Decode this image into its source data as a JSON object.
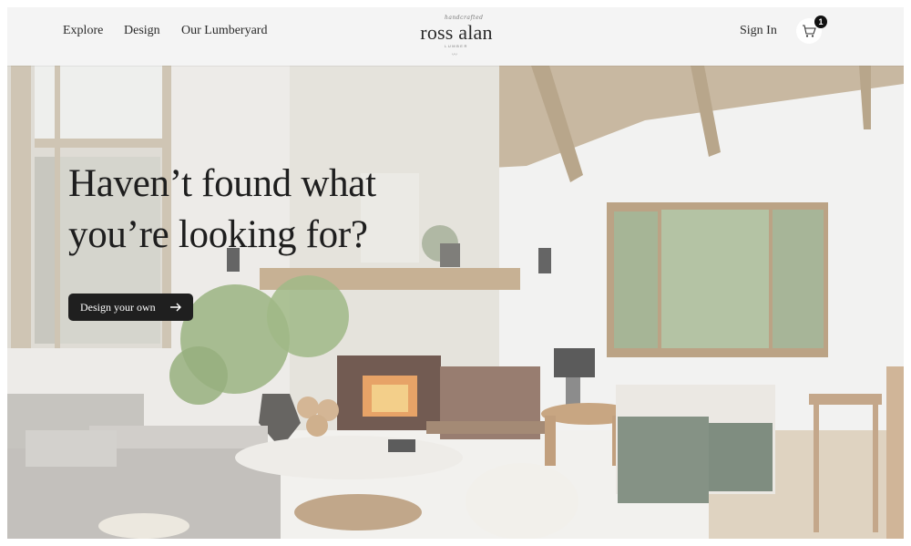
{
  "nav": {
    "links": [
      "Explore",
      "Design",
      "Our Lumberyard"
    ],
    "sign_in": "Sign In",
    "cart_count": "1"
  },
  "logo": {
    "script": "handcrafted",
    "name": "ross alan",
    "sub": "LUMBER"
  },
  "hero": {
    "headline_line1": "Haven’t found what",
    "headline_line2": "you’re looking for?",
    "cta_label": "Design your own"
  },
  "colors": {
    "cta_bg": "#1f1f1f",
    "nav_bg": "#f4f4f4",
    "badge_bg": "#111111"
  },
  "icons": [
    "cart-icon",
    "arrow-right-icon"
  ]
}
